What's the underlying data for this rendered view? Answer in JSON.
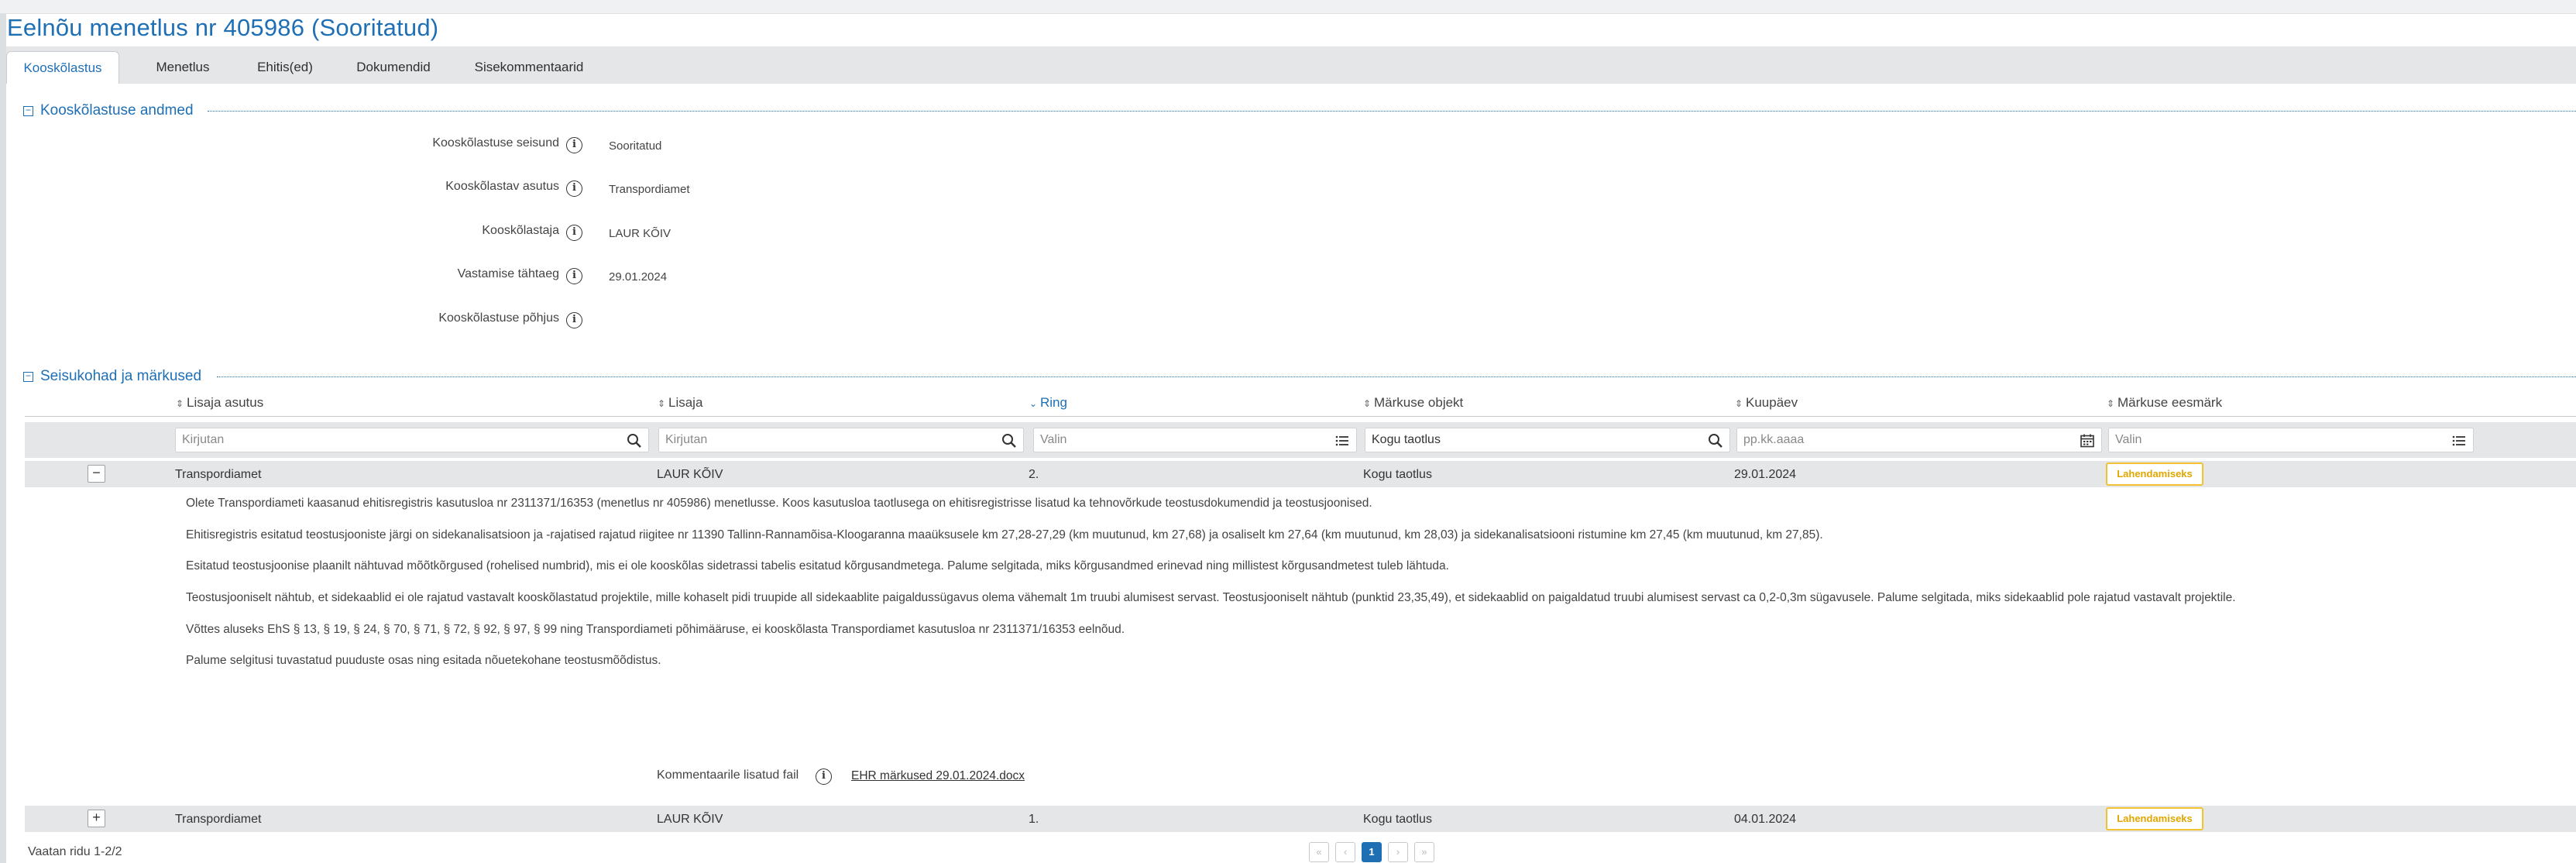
{
  "page": {
    "title": "Eelnõu menetlus nr 405986 (Sooritatud)"
  },
  "tabs": [
    "Kooskõlastus",
    "Menetlus",
    "Ehitis(ed)",
    "Dokumendid",
    "Sisekommentaarid"
  ],
  "active_tab": "Kooskõlastus",
  "section1": {
    "title": "Kooskõlastuse andmed",
    "fields": [
      {
        "label": "Kooskõlastuse seisund",
        "value": "Sooritatud"
      },
      {
        "label": "Kooskõlastav asutus",
        "value": "Transpordiamet"
      },
      {
        "label": "Kooskõlastaja",
        "value": "LAUR KÕIV"
      },
      {
        "label": "Vastamise tähtaeg",
        "value": "29.01.2024"
      },
      {
        "label": "Kooskõlastuse põhjus",
        "value": ""
      }
    ]
  },
  "section2": {
    "title": "Seisukohad ja märkused",
    "columns": [
      "Lisaja asutus",
      "Lisaja",
      "Ring",
      "Märkuse objekt",
      "Kuupäev",
      "Märkuse eesmärk"
    ],
    "filters": [
      "Kirjutan",
      "Kirjutan",
      "Valin",
      "Kogu taotlus",
      "pp.kk.aaaa",
      "Valin"
    ],
    "rows": [
      {
        "expander": "−",
        "asutus": "Transpordiamet",
        "lisaja": "LAUR KÕIV",
        "ring": "2.",
        "objekt": "Kogu taotlus",
        "kuupaev": "29.01.2024",
        "eesmark": "Lahendamiseks",
        "paragraphs": [
          "Olete Transpordiameti kaasanud ehitisregistris kasutusloa nr 2311371/16353 (menetlus nr 405986) menetlusse. Koos kasutusloa taotlusega on ehitisregistrisse lisatud ka tehnovõrkude teostusdokumendid ja teostusjoonised.",
          "Ehitisregistris esitatud teostusjooniste järgi on sidekanalisatsioon ja -rajatised rajatud riigitee nr 11390 Tallinn-Rannamõisa-Kloogaranna maaüksusele km 27,28-27,29 (km muutunud, km 27,68) ja osaliselt km 27,64 (km muutunud, km 28,03) ja sidekanalisatsiooni ristumine km 27,45 (km muutunud, km 27,85).",
          "Esitatud teostusjoonise plaanilt nähtuvad mõõtkõrgused (rohelised numbrid), mis ei ole kooskõlas sidetrassi tabelis esitatud kõrgusandmetega. Palume selgitada, miks kõrgusandmed erinevad ning millistest kõrgusandmetest tuleb lähtuda.",
          "Teostusjooniselt nähtub, et sidekaablid ei ole rajatud vastavalt kooskõlastatud projektile, mille kohaselt pidi truupide all sidekaablite paigaldussügavus olema vähemalt 1m truubi alumisest servast. Teostusjooniselt nähtub (punktid 23,35,49), et sidekaablid on paigaldatud truubi alumisest servast ca 0,2-0,3m sügavusele. Palume selgitada, miks sidekaablid pole rajatud vastavalt projektile.",
          "Võttes aluseks EhS § 13, § 19, § 24, § 70, § 71, § 72, § 92, § 97, § 99 ning Transpordiameti põhimääruse, ei kooskõlasta Transpordiamet kasutusloa nr 2311371/16353 eelnõud.",
          "Palume selgitusi tuvastatud puuduste osas ning esitada nõuetekohane teostusmõõdistus."
        ],
        "attachment_label": "Kommentaarile lisatud fail",
        "attachment_file": "EHR märkused 29.01.2024.docx"
      },
      {
        "expander": "+",
        "asutus": "Transpordiamet",
        "lisaja": "LAUR KÕIV",
        "ring": "1.",
        "objekt": "Kogu taotlus",
        "kuupaev": "04.01.2024",
        "eesmark": "Lahendamiseks"
      }
    ]
  },
  "footer": {
    "summary": "Vaatan ridu 1-2/2",
    "pager": {
      "first": "«",
      "prev": "‹",
      "current": "1",
      "next": "›",
      "last": "»"
    }
  },
  "colors": {
    "accent": "#1f6fb5",
    "badge": "#f2c230",
    "band": "#e4e6e8"
  },
  "icons": [
    "info-icon",
    "search-icon",
    "list-icon",
    "calendar-icon",
    "sort-icon",
    "sort-desc-icon"
  ]
}
